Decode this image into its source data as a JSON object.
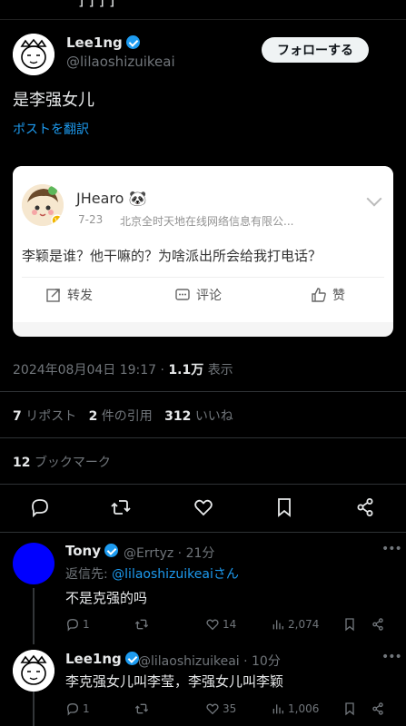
{
  "top_fragment": "] ] ] ]",
  "post": {
    "author_name": "Lee1ng",
    "author_handle": "@lilaoshizuikeai",
    "follow_label": "フォローする",
    "text": "是李强女儿",
    "translate_label": "ポストを翻訳",
    "timestamp": "2024年08月04日 19:17",
    "views_count": "1.1万",
    "views_label": "表示",
    "reposts_count": "7",
    "reposts_label": "リポスト",
    "quotes_count": "2",
    "quotes_label": "件の引用",
    "likes_count": "312",
    "likes_label": "いいね",
    "bookmarks_count": "12",
    "bookmarks_label": "ブックマーク"
  },
  "embed": {
    "name": "JHearo",
    "name_emoji": "🐼",
    "date": "7-23",
    "source": "北京全时天地在线网络信息有限公...",
    "text": "李颖是谁？他干嘛的？为啥派出所会给我打电话？",
    "forward_label": "转发",
    "comment_label": "评论",
    "like_label": "赞"
  },
  "actions": {
    "reply_icon": "reply-icon",
    "repost_icon": "repost-icon",
    "like_icon": "heart-icon",
    "bookmark_icon": "bookmark-icon",
    "share_icon": "share-icon"
  },
  "replies": [
    {
      "name": "Tony",
      "handle": "@Errtyz · 21分",
      "replying_prefix": "返信先: ",
      "replying_to": "@lilaoshizuikeai",
      "replying_suffix": "さん",
      "text": "不是克强的吗",
      "reply_count": "1",
      "repost_count": "",
      "like_count": "14",
      "views_count": "2,074"
    },
    {
      "name": "Lee1ng",
      "handle": "@lilaoshizuikeai · 10分",
      "text": "李克强女儿叫李莹，李强女儿叫李颖",
      "reply_count": "1",
      "repost_count": "",
      "like_count": "35",
      "views_count": "1,006"
    }
  ],
  "colors": {
    "accent": "#1d9bf0",
    "background": "#000000",
    "muted": "#71767b"
  }
}
